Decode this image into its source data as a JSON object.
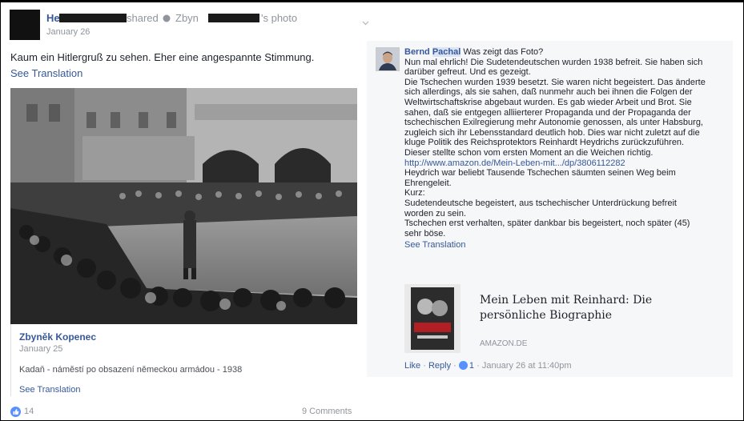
{
  "post": {
    "author_visible": "Hei",
    "shared_text": "shared",
    "shared_from_visible": "Zbyn",
    "photo_label": "'s photo",
    "date": "January 26",
    "text": "Kaum ein Hitlergruß zu sehen. Eher eine angespannte Stimmung.",
    "see_translation": "See Translation"
  },
  "shared_photo": {
    "author": "Zbyněk Kopenec",
    "date": "January 25",
    "caption": "Kadaň - náměstí po obsazení německou armádou - 1938",
    "see_translation": "See Translation"
  },
  "footer": {
    "likes": "14",
    "comments": "9 Comments"
  },
  "comment": {
    "author_first": "Bernd",
    "author_last": "Pachal",
    "lines": [
      "Was zeigt das Foto?",
      "Nun mal ehrlich! Die Sudetendeutschen wurden 1938 befreit. Sie haben sich",
      "darüber gefreut. Und es gezeigt.",
      "Die Tschechen wurden 1939 besetzt. Sie waren nicht begeistert. Das änderte",
      "sich allerdings, als sie sahen, daß nunmehr auch bei ihnen die Folgen der",
      "Weltwirtschaftskrise abgebaut wurden. Es gab wieder Arbeit und Brot. Sie",
      "sahen, daß sie entgegen alliierterer Propaganda und der Propaganda der",
      "tschechischen Exilregierung mehr Autonomie genossen, als unter Habsburg,",
      "zugleich sich ihr Lebensstandard deutlich hob. Dies war nicht zuletzt auf die",
      "kluge Politik des Reichsprotektors Reinhardt Heydrichs zurückzuführen.",
      "Dieser stellte schon vom ersten Moment an die Weichen richtig.",
      "http://www.amazon.de/Mein-Leben-mit.../dp/3806112282",
      "Heydrich war beliebt Tausende Tschechen säumten seinen Weg beim",
      "Ehrengeleit.",
      "Kurz:",
      "Sudetendeutsche begeistert, aus tschechischer Unterdrückung befreit",
      "worden zu sein.",
      "Tschechen erst verhalten, später dankbar bis begeistert, noch später (45)",
      "sehr böse."
    ],
    "see_translation": "See Translation",
    "link_card": {
      "title": "Mein Leben mit Reinhard: Die persönliche Biographie",
      "source": "AMAZON.DE"
    },
    "actions": {
      "like": "Like",
      "reply": "Reply",
      "like_count": "1",
      "timestamp": "January 26 at 11:40pm"
    }
  },
  "colors": {
    "link": "#365899",
    "muted": "#90949c",
    "panel": "#f6f7f9",
    "like_blue": "#5890ff"
  }
}
